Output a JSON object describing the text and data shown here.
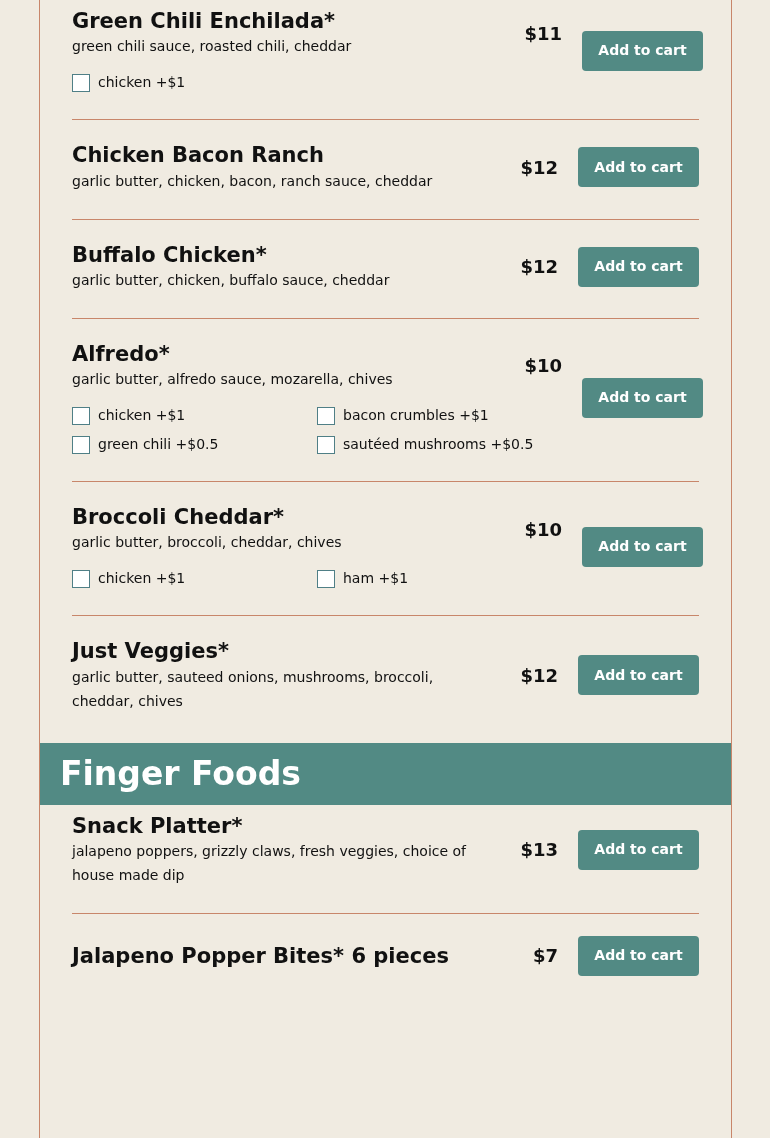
{
  "sections": [
    {
      "items": [
        {
          "name": "Green Chili Enchilada*",
          "description": "green chili sauce, roasted chili, cheddar",
          "price": "$11",
          "button": "Add to cart",
          "options": [
            {
              "label": "chicken +$1",
              "checked": false
            }
          ]
        },
        {
          "name": "Chicken Bacon Ranch",
          "description": "garlic butter, chicken, bacon, ranch sauce, cheddar",
          "price": "$12",
          "button": "Add to cart"
        },
        {
          "name": "Buffalo Chicken*",
          "description": "garlic butter, chicken, buffalo sauce, cheddar",
          "price": "$12",
          "button": "Add to cart"
        },
        {
          "name": "Alfredo*",
          "description": "garlic butter, alfredo sauce, mozarella, chives",
          "price": "$10",
          "button": "Add to cart",
          "options": [
            {
              "label": "chicken +$1",
              "checked": false
            },
            {
              "label": "bacon crumbles +$1",
              "checked": false
            },
            {
              "label": "green chili +$0.5",
              "checked": false
            },
            {
              "label": "sautéed mushrooms +$0.5",
              "checked": false
            }
          ]
        },
        {
          "name": "Broccoli Cheddar*",
          "description": "garlic butter, broccoli, cheddar, chives",
          "price": "$10",
          "button": "Add to cart",
          "options": [
            {
              "label": "chicken +$1",
              "checked": false
            },
            {
              "label": "ham +$1",
              "checked": false
            }
          ]
        },
        {
          "name": "Just Veggies*",
          "description": "garlic butter, sauteed onions, mushrooms, broccoli, cheddar, chives",
          "price": "$12",
          "button": "Add to cart"
        }
      ]
    },
    {
      "heading": "Finger Foods",
      "items": [
        {
          "name": "Snack Platter*",
          "description": "jalapeno poppers, grizzly claws, fresh veggies, choice of house made dip",
          "price": "$13",
          "button": "Add to cart"
        },
        {
          "name": "Jalapeno Popper Bites* 6 pieces",
          "price": "$7",
          "button": "Add to cart"
        }
      ]
    }
  ]
}
